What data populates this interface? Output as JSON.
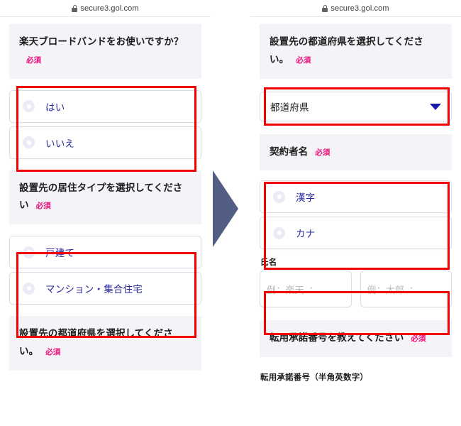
{
  "browser": {
    "url": "secure3.gol.com",
    "lock_icon": "lock-icon"
  },
  "left_panel": {
    "sections": [
      {
        "question": "楽天ブロードバンドをお使いですか？",
        "required_badge": "必須",
        "options": [
          {
            "label": "はい"
          },
          {
            "label": "いいえ"
          }
        ]
      },
      {
        "question": "設置先の居住タイプを選択してください",
        "required_badge": "必須",
        "options": [
          {
            "label": "戸建て"
          },
          {
            "label": "マンション・集合住宅"
          }
        ]
      },
      {
        "question": "設置先の都道府県を選択してください。",
        "required_badge": "必須"
      }
    ]
  },
  "right_panel": {
    "prefecture_section": {
      "question": "設置先の都道府県を選択してください。",
      "required_badge": "必須",
      "select_value": "都道府県",
      "caret_icon": "chevron-down-icon"
    },
    "contractor_section": {
      "question": "契約者名",
      "required_badge": "必須",
      "options": [
        {
          "label": "漢字"
        },
        {
          "label": "カナ"
        }
      ]
    },
    "name_section": {
      "label": "氏名",
      "last_name_placeholder": "例：楽天、：",
      "first_name_placeholder": "例：太郎、："
    },
    "transfer_section": {
      "question": "転用承諾番号を教えてください",
      "required_badge": "必須",
      "field_label": "転用承諾番号（半角英数字）"
    }
  },
  "annotations": {
    "arrow_color": "#515d82",
    "highlight_color": "#f50000"
  }
}
